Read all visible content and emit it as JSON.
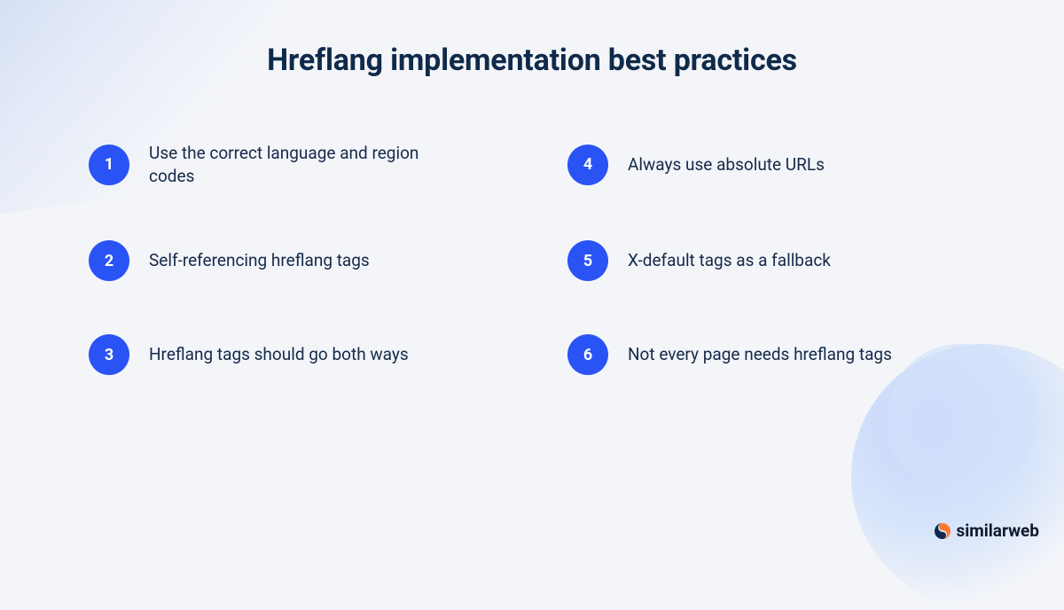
{
  "title": "Hreflang implementation best practices",
  "colors": {
    "background": "#f3f5f9",
    "heading": "#0f2a4a",
    "body_text": "#16294a",
    "badge_bg": "#2a53f5",
    "badge_text": "#ffffff"
  },
  "items": [
    {
      "number": "1",
      "text": "Use the correct language and region codes"
    },
    {
      "number": "2",
      "text": "Self-referencing hreflang tags"
    },
    {
      "number": "3",
      "text": "Hreflang tags should go both ways"
    },
    {
      "number": "4",
      "text": "Always use absolute URLs"
    },
    {
      "number": "5",
      "text": "X-default tags as a fallback"
    },
    {
      "number": "6",
      "text": "Not every page needs hreflang tags"
    }
  ],
  "logo": {
    "text": "similarweb",
    "icon_name": "similarweb-logo-icon"
  }
}
